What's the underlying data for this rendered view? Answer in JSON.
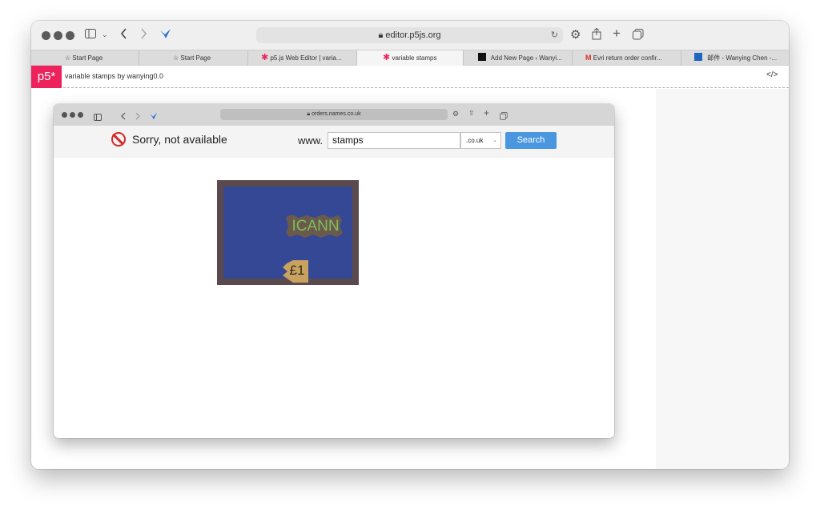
{
  "outer_browser": {
    "url": "editor.p5js.org",
    "tabs": [
      {
        "label": "Start Page",
        "icon": "star-icon"
      },
      {
        "label": "Start Page",
        "icon": "star-icon"
      },
      {
        "label": "p5.js Web Editor | varia...",
        "icon": "p5-asterisk-icon"
      },
      {
        "label": "variable stamps",
        "icon": "p5-asterisk-icon",
        "active": true
      },
      {
        "label": "Add New Page ‹ Wanyi...",
        "icon": "wordpress-icon"
      },
      {
        "label": "Evri return order confir...",
        "icon": "gmail-icon"
      },
      {
        "label": "邮件 - Wanying Chen -...",
        "icon": "outlook-icon"
      }
    ]
  },
  "p5_editor": {
    "logo": "p5*",
    "sketch_title": "variable stamps by wanying0.0",
    "code_toggle": "</>"
  },
  "inner_browser": {
    "url": "orders.names.co.uk"
  },
  "name_search": {
    "status_text": "Sorry, not available",
    "prefix": "www.",
    "domain_value": "stamps",
    "tld_value": ".co.uk",
    "search_label": "Search"
  },
  "stamp": {
    "label": "ICANN",
    "price": "£1",
    "colors": {
      "frame": "#5b4a4d",
      "background": "#354895",
      "label_text": "#7dbf5a",
      "label_bg": "#6a5a4c",
      "price_tag": "#c8a25e"
    }
  },
  "colors": {
    "p5_brand": "#ed225d",
    "search_button": "#4a97e0",
    "unavailable": "#d62828"
  }
}
